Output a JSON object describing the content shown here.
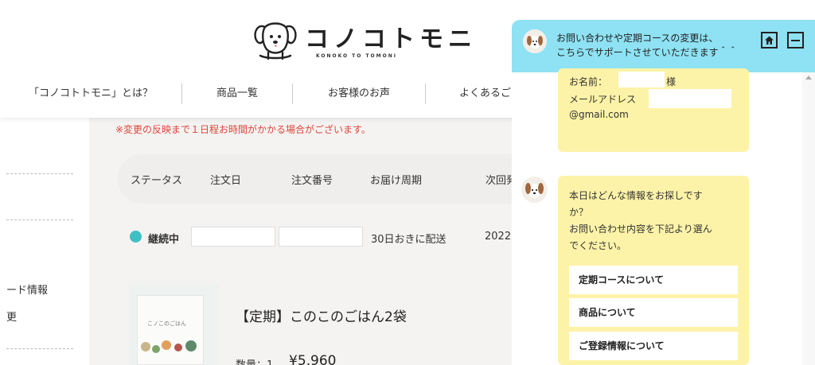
{
  "header": {
    "logo_text": "コノコトモニ",
    "logo_sub": "KONOKO TO TOMONI"
  },
  "nav": {
    "items": [
      {
        "label": "「コノコトトモニ」とは？"
      },
      {
        "label": "商品一覧"
      },
      {
        "label": "お客様のお声"
      },
      {
        "label": "よくあるご"
      }
    ]
  },
  "sidebar": {
    "items": [
      {
        "label": "ード情報"
      },
      {
        "label": "更"
      }
    ]
  },
  "main": {
    "notice": "※変更の反映まで１日程お時間がかかる場合がございます。",
    "table": {
      "headers": [
        "ステータス",
        "注文日",
        "注文番号",
        "お届け周期",
        "次回発"
      ],
      "row": {
        "status": "継続中",
        "order_date": "",
        "order_number": "",
        "cycle": "30日おきに配送",
        "next_date": "2022."
      }
    },
    "product": {
      "bag_label": "こノこのごはん",
      "name": "【定期】このこのごはん2袋",
      "qty": "数量：1",
      "price": "¥5,960"
    }
  },
  "chat": {
    "header_line1": "お問い合わせや定期コースの変更は、",
    "header_line2": "こちらでサポートさせていただきます＾＾",
    "home_icon": "home-icon",
    "minimize_icon": "minimize-icon",
    "user_bubble": {
      "name_label": "お名前：",
      "name_suffix": "様",
      "email_label": "メールアドレス",
      "email_domain": "@gmail.com"
    },
    "bot_bubble": {
      "line1": "本日はどんな情報をお探しです",
      "line2": "か？",
      "line3": "お問い合わせ内容を下記より選ん",
      "line4": "でください。"
    },
    "options": [
      {
        "label": "定期コースについて"
      },
      {
        "label": "商品について"
      },
      {
        "label": "ご登録情報について"
      }
    ],
    "colors": {
      "header_bg": "#8ee2f3",
      "bubble_bg": "#fdf3a8",
      "status_dot": "#3fbfc4",
      "notice_text": "#e0453a"
    }
  }
}
